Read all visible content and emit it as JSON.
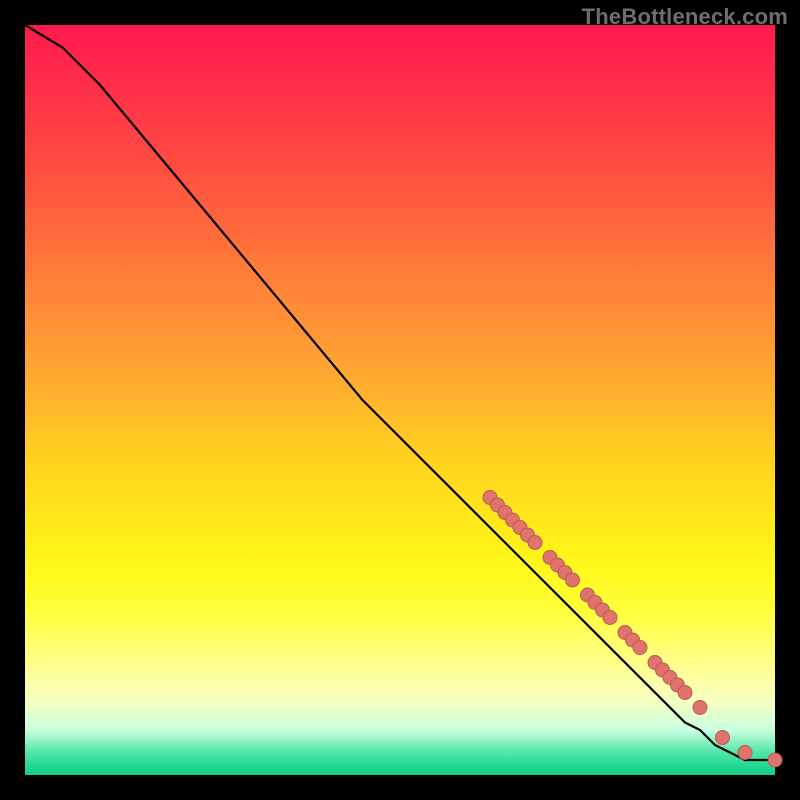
{
  "watermark": "TheBottleneck.com",
  "colors": {
    "marker_fill": "#e0746c",
    "marker_stroke": "#b85a53",
    "curve": "#000000"
  },
  "chart_data": {
    "type": "line",
    "title": "",
    "xlabel": "",
    "ylabel": "",
    "xlim": [
      0,
      100
    ],
    "ylim": [
      0,
      100
    ],
    "grid": false,
    "legend": false,
    "series": [
      {
        "name": "curve",
        "kind": "line",
        "x": [
          0,
          5,
          10,
          15,
          20,
          25,
          30,
          35,
          40,
          45,
          50,
          55,
          60,
          62,
          65,
          68,
          70,
          72,
          74,
          76,
          78,
          80,
          82,
          84,
          86,
          88,
          90,
          92,
          94,
          96,
          98,
          100
        ],
        "y": [
          100,
          97,
          92,
          86,
          80,
          74,
          68,
          62,
          56,
          50,
          45,
          40,
          35,
          33,
          30,
          27,
          25,
          23,
          21,
          19,
          17,
          15,
          13,
          11,
          9,
          7,
          6,
          4,
          3,
          2,
          2,
          2
        ]
      },
      {
        "name": "markers",
        "kind": "scatter",
        "x": [
          62,
          63,
          64,
          65,
          66,
          67,
          68,
          70,
          71,
          72,
          73,
          75,
          76,
          77,
          78,
          80,
          81,
          82,
          84,
          85,
          86,
          87,
          88,
          90,
          93,
          96,
          100
        ],
        "y": [
          37,
          36,
          35,
          34,
          33,
          32,
          31,
          29,
          28,
          27,
          26,
          24,
          23,
          22,
          21,
          19,
          18,
          17,
          15,
          14,
          13,
          12,
          11,
          9,
          5,
          3,
          2
        ]
      }
    ]
  }
}
